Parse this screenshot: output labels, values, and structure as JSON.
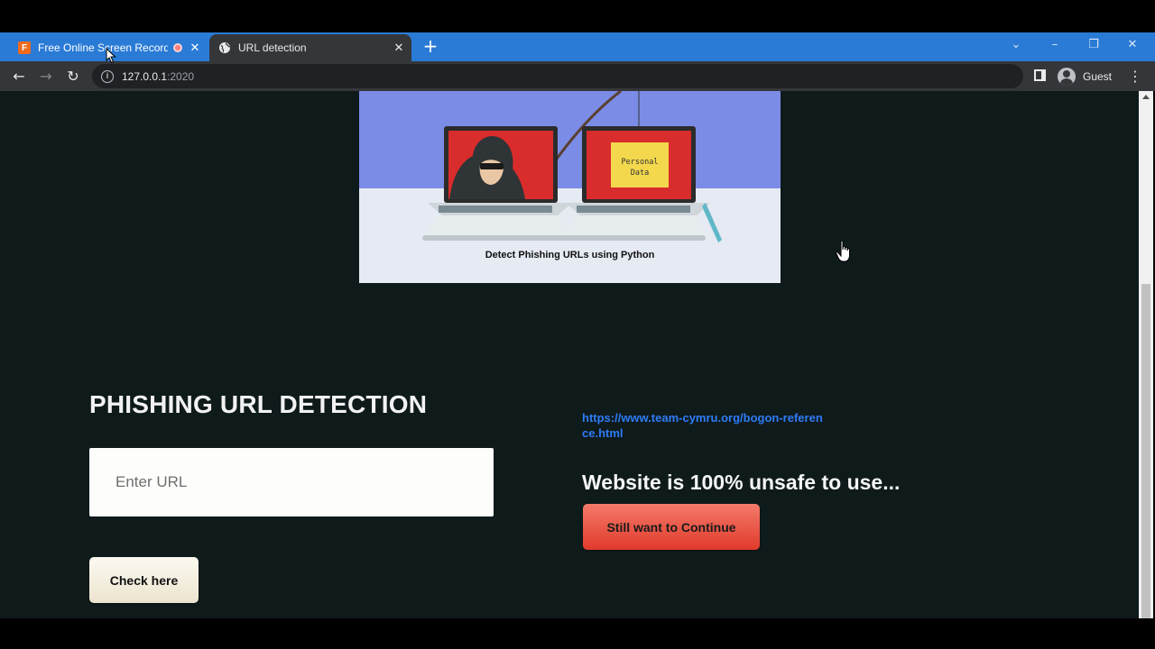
{
  "browser": {
    "tabs": [
      {
        "title": "Free Online Screen Recorder",
        "favicon": "free-online-screen-recorder-icon",
        "recording": true,
        "active": false
      },
      {
        "title": "URL detection",
        "favicon": "globe-icon",
        "active": true
      }
    ],
    "new_tab_glyph": "+",
    "window_controls": {
      "dropdown": "⌄",
      "minimize": "–",
      "restore": "❐",
      "close": "✕"
    },
    "nav": {
      "back": "←",
      "forward": "→",
      "reload": "↻"
    },
    "address": {
      "host": "127.0.0.1",
      "port": ":2020"
    },
    "profile_label": "Guest",
    "menu_glyph": "⋮",
    "theme_color": "#2a7bd6"
  },
  "page": {
    "banner": {
      "sticky_note": [
        "Personal",
        "Data"
      ],
      "caption": "Detect Phishing URLs using Python"
    },
    "heading": "PHISHING URL DETECTION",
    "url_input": {
      "placeholder": "Enter URL",
      "value": ""
    },
    "check_button": "Check here",
    "result": {
      "checked_url": "https://www.team-cymru.org/bogon-reference.html",
      "verdict": "Website is 100% unsafe to use...",
      "continue_button": "Still want to Continue",
      "accent_color": "#e6483a"
    },
    "background_color": "#0f1a1b"
  }
}
